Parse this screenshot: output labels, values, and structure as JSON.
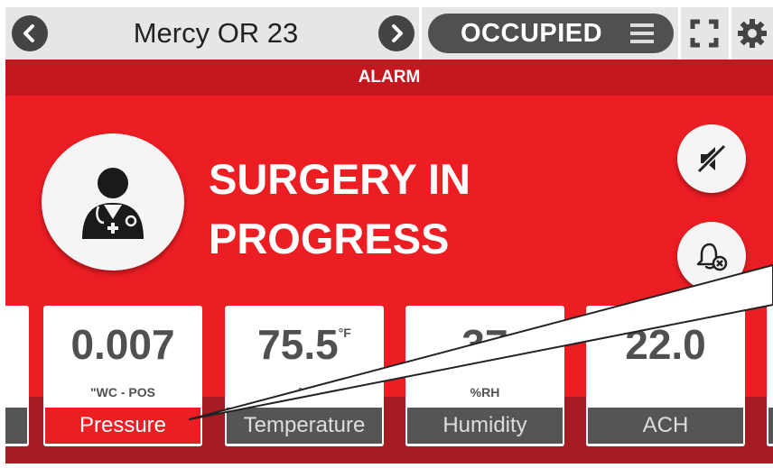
{
  "header": {
    "room_name": "Mercy OR 23",
    "status": "OCCUPIED"
  },
  "alarm": {
    "banner": "ALARM",
    "headline_line1": "SURGERY IN",
    "headline_line2": "PROGRESS"
  },
  "tiles": [
    {
      "value": "0.007",
      "superscript": "",
      "unit": "\"WC - POS",
      "label": "Pressure",
      "active": true
    },
    {
      "value": "75.5",
      "superscript": "°F",
      "unit": "°F",
      "label": "Temperature",
      "active": false
    },
    {
      "value": "37",
      "superscript": "",
      "unit": "%RH",
      "label": "Humidity",
      "active": false
    },
    {
      "value": "22.0",
      "superscript": "",
      "unit": "",
      "label": "ACH",
      "active": false
    }
  ],
  "icons": {
    "prev": "chevron-left-icon",
    "next": "chevron-right-icon",
    "menu": "menu-icon",
    "fullscreen": "fullscreen-icon",
    "settings": "gear-icon",
    "doctor": "doctor-icon",
    "mute": "mute-icon",
    "alarm_off": "alarm-off-icon"
  },
  "colors": {
    "alarm_red": "#ed1d24",
    "alarm_dark_red": "#c4171f",
    "tile_label_gray": "#555555"
  }
}
